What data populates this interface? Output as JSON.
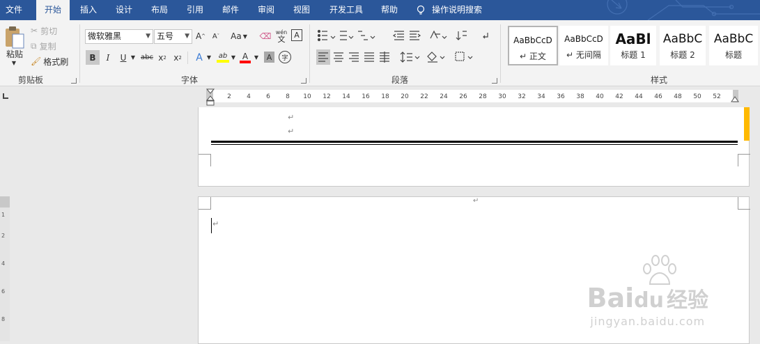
{
  "tabs": [
    {
      "label": "文件"
    },
    {
      "label": "开始"
    },
    {
      "label": "插入"
    },
    {
      "label": "设计"
    },
    {
      "label": "布局"
    },
    {
      "label": "引用"
    },
    {
      "label": "邮件"
    },
    {
      "label": "审阅"
    },
    {
      "label": "视图"
    },
    {
      "label": "开发工具"
    },
    {
      "label": "帮助"
    }
  ],
  "search_label": "操作说明搜索",
  "clipboard": {
    "paste": "粘贴",
    "cut": "剪切",
    "copy": "复制",
    "format_painter": "格式刷",
    "group": "剪贴板"
  },
  "font": {
    "name": "微软雅黑",
    "size": "五号",
    "case": "Aa",
    "phonetic": "wén",
    "phonetic_char": "文",
    "border_char": "A",
    "bold": "B",
    "italic": "I",
    "underline": "U",
    "strike": "abc",
    "sub": "x",
    "sub_mark": "2",
    "sup": "x",
    "sup_mark": "2",
    "effects": "A",
    "highlight": "ab",
    "color": "A",
    "shade": "A",
    "enclose": "字",
    "group": "字体"
  },
  "paragraph": {
    "group": "段落"
  },
  "styles": {
    "items": [
      {
        "preview": "AaBbCcD",
        "name": "正文"
      },
      {
        "preview": "AaBbCcD",
        "name": "无间隔"
      },
      {
        "preview": "AaBl",
        "name": "标题 1"
      },
      {
        "preview": "AaBbC",
        "name": "标题 2"
      },
      {
        "preview": "AaBbC",
        "name": "标题"
      }
    ],
    "group": "样式"
  },
  "ruler_ticks": [
    "2",
    "4",
    "6",
    "8",
    "10",
    "12",
    "14",
    "16",
    "18",
    "20",
    "22",
    "24",
    "26",
    "28",
    "30",
    "32",
    "34",
    "36",
    "38",
    "40",
    "42",
    "44",
    "46",
    "48",
    "50",
    "52"
  ],
  "vruler_ticks": [
    "1",
    "2",
    "4",
    "6",
    "8"
  ],
  "watermark": {
    "brand": "Bai",
    "brand2": "du",
    "brand3": "经验",
    "url": "jingyan.baidu.com"
  },
  "colors": {
    "accent": "#2b579a",
    "highlight": "#ffff00",
    "font_color": "#ff0000",
    "scroll": "#ffb900"
  }
}
